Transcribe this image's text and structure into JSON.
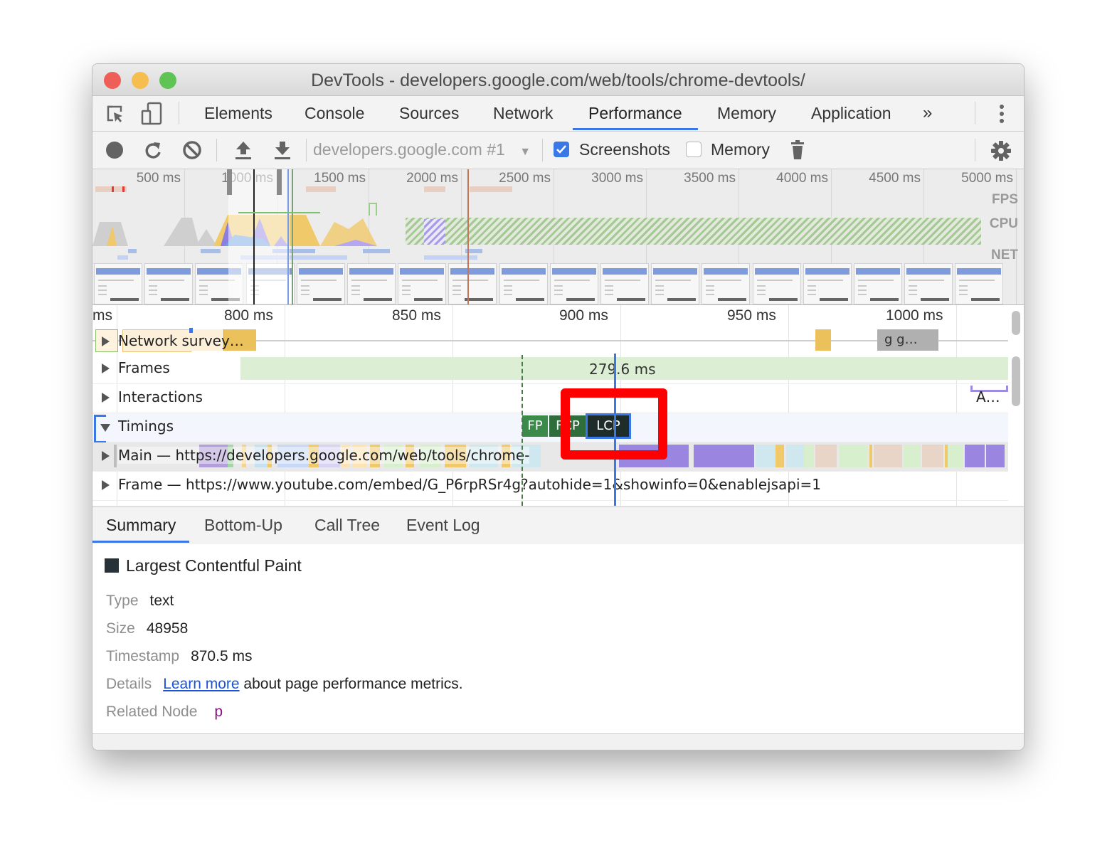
{
  "window": {
    "title": "DevTools - developers.google.com/web/tools/chrome-devtools/",
    "traffic_lights": {
      "close": "#ee5f58",
      "minimize": "#f5be4f",
      "zoom": "#5fc454"
    }
  },
  "main_tabs": {
    "inspect_icon": "inspect-element-icon",
    "device_icon": "device-toolbar-icon",
    "items": [
      {
        "label": "Elements",
        "active": false
      },
      {
        "label": "Console",
        "active": false
      },
      {
        "label": "Sources",
        "active": false
      },
      {
        "label": "Network",
        "active": false
      },
      {
        "label": "Performance",
        "active": true
      },
      {
        "label": "Memory",
        "active": false
      },
      {
        "label": "Application",
        "active": false
      }
    ],
    "more_label": "»",
    "menu_icon": "kebab-menu-icon"
  },
  "toolbar": {
    "record_icon": "record-icon",
    "reload_icon": "reload-icon",
    "clear_icon": "clear-icon",
    "upload_icon": "upload-icon",
    "download_icon": "download-icon",
    "profile_select": "developers.google.com #1",
    "screenshots_label": "Screenshots",
    "screenshots_checked": true,
    "memory_label": "Memory",
    "memory_checked": false,
    "trash_icon": "trash-icon",
    "settings_icon": "gear-icon",
    "accent": "#3b78e7"
  },
  "overview": {
    "ticks": [
      "500 ms",
      "1000 ms",
      "1500 ms",
      "2000 ms",
      "2500 ms",
      "3000 ms",
      "3500 ms",
      "4000 ms",
      "4500 ms",
      "5000 ms"
    ],
    "lane_labels": {
      "fps": "FPS",
      "cpu": "CPU",
      "net": "NET"
    }
  },
  "flamechart": {
    "ticks": [
      "ms",
      "800 ms",
      "850 ms",
      "900 ms",
      "950 ms",
      "1000 ms"
    ],
    "tracks": [
      {
        "label": "Network",
        "extra": "survey…",
        "expanded": false
      },
      {
        "label": "Frames",
        "expanded": false
      },
      {
        "label": "Interactions",
        "expanded": false
      },
      {
        "label": "Timings",
        "expanded": true
      },
      {
        "label": "Main — https://developers.google.com/web/tools/chrome-",
        "expanded": false
      },
      {
        "label": "Frame — https://www.youtube.com/embed/G_P6rpRSr4g?autohide=1&showinfo=0&enablejsapi=1",
        "expanded": false
      }
    ],
    "network_trailing": "g g…",
    "frame_duration": "279.6 ms",
    "interaction_label": "A…",
    "timing_marks": [
      {
        "label": "FP",
        "color": "#3b8a4a"
      },
      {
        "label": "FCP",
        "color": "#2f6e3a"
      },
      {
        "label": "LCP",
        "color": "#1f2d2a",
        "selected": true
      }
    ],
    "highlight_color": "#ff0000"
  },
  "bottom_tabs": [
    {
      "label": "Summary",
      "active": true
    },
    {
      "label": "Bottom-Up",
      "active": false
    },
    {
      "label": "Call Tree",
      "active": false
    },
    {
      "label": "Event Log",
      "active": false
    }
  ],
  "summary": {
    "title": "Largest Contentful Paint",
    "swatch_color": "#263238",
    "rows": [
      {
        "key": "Type",
        "value": "text"
      },
      {
        "key": "Size",
        "value": "48958"
      },
      {
        "key": "Timestamp",
        "value": "870.5 ms"
      },
      {
        "key": "Details",
        "link": "Learn more",
        "value": " about page performance metrics."
      },
      {
        "key": "Related Node",
        "value": "p"
      }
    ]
  }
}
